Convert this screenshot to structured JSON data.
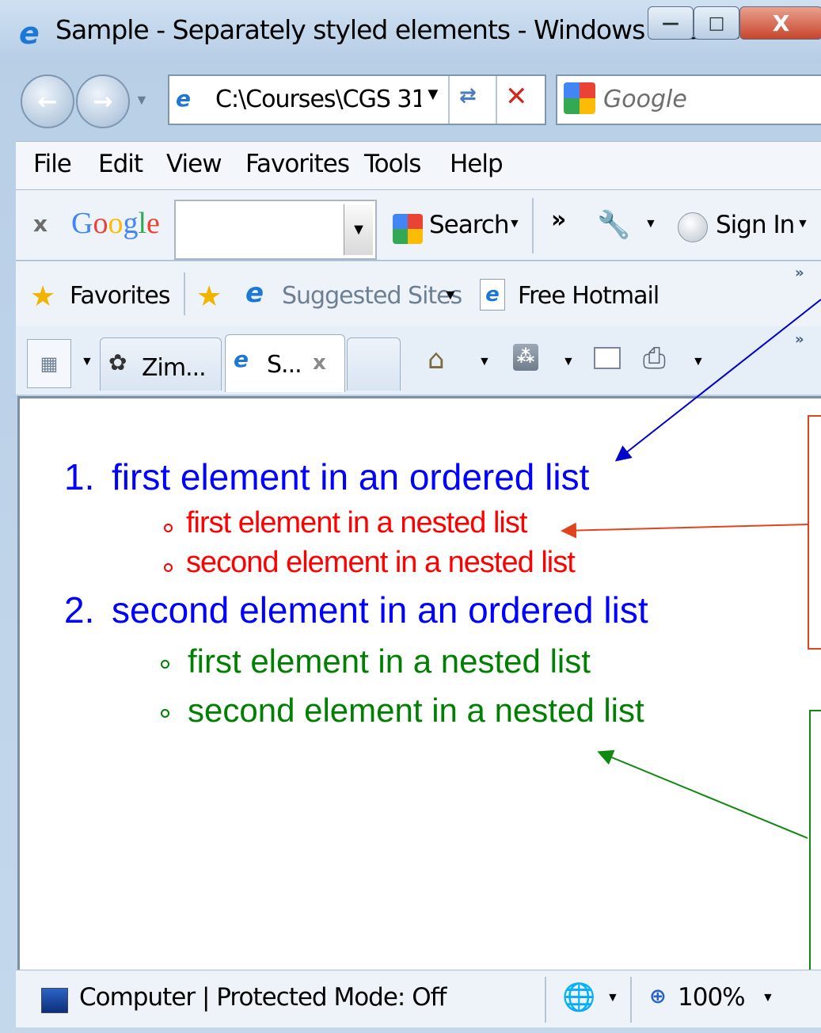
{
  "window": {
    "title": "Sample - Separately styled elements - Windows Internet...",
    "minimize_label": "—",
    "maximize_label": "□",
    "close_label": "X"
  },
  "navigation": {
    "address": "C:\\Courses\\CGS 31",
    "search_placeholder": "Google"
  },
  "menu": [
    "File",
    "Edit",
    "View",
    "Favorites",
    "Tools",
    "Help"
  ],
  "google_toolbar": {
    "close_label": "x",
    "logo": "Google",
    "search_value": "",
    "search_label": "Search",
    "more_label": "»",
    "signin_label": "Sign In"
  },
  "favorites_bar": {
    "favorites_label": "Favorites",
    "suggested_sites_label": "Suggested Sites",
    "hotmail_label": "Free Hotmail",
    "more_label": "»"
  },
  "tabs": [
    {
      "label": "Zim...",
      "active": false
    },
    {
      "label": "S...",
      "active": true,
      "close_label": "x"
    }
  ],
  "content": {
    "ordered_list": [
      {
        "number": "1.",
        "text": "first element in an ordered list",
        "nested": [
          "first element in a nested list",
          "second element in a nested list"
        ],
        "nested_color": "#ff0000"
      },
      {
        "number": "2.",
        "text": "second element in an ordered list",
        "nested": [
          "first element in a nested list",
          "second element in a nested list"
        ],
        "nested_color": "#008000"
      }
    ],
    "ordered_color": "#0000ff"
  },
  "callouts": {
    "red_color": "#e0441c",
    "green_color": "#0f8a0f",
    "blue_color": "#0000cc"
  },
  "statusbar": {
    "status_text": "Computer | Protected Mode: Off",
    "zoom": "100%"
  }
}
